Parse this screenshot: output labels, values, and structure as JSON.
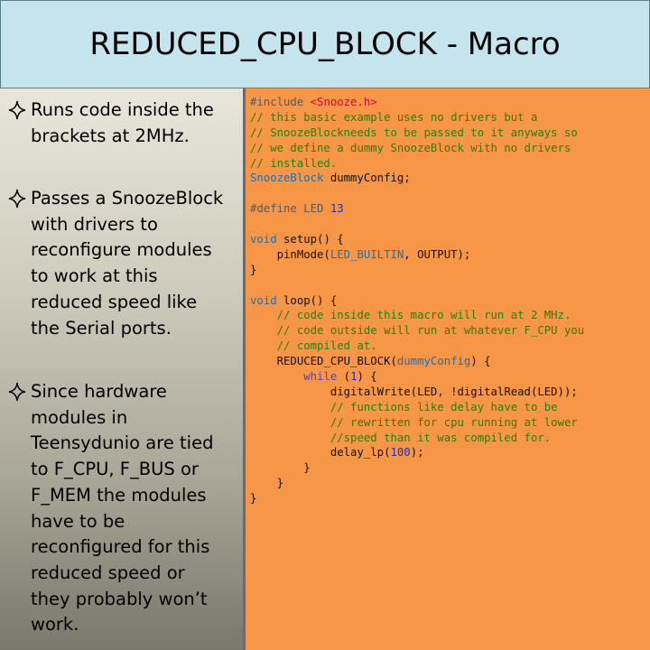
{
  "title": "REDUCED_CPU_BLOCK - Macro",
  "bullets": [
    {
      "icon": "four-pointed-star-icon",
      "lines": [
        "Runs code inside the",
        "brackets at 2MHz."
      ]
    },
    {
      "icon": "four-pointed-star-icon",
      "lines": [
        "Passes a SnoozeBlock",
        "with drivers to",
        "reconfigure modules",
        "to work at this",
        "reduced speed like",
        "the Serial ports."
      ]
    },
    {
      "icon": "four-pointed-star-icon",
      "lines": [
        "Since hardware",
        "modules in",
        "Teensydunio are tied",
        "to F_CPU, F_BUS or",
        "F_MEM the modules",
        "have to be",
        "reconfigured for this",
        "reduced speed or",
        "they probably won’t",
        "work."
      ]
    }
  ],
  "colors": {
    "title_background": "#c6e4ee",
    "code_background": "#f79646",
    "comment": "#2d7d0c",
    "string": "#c8102e",
    "type": "#1b6fb5",
    "number": "#2b2bb0",
    "keyword": "#5a3fb8"
  },
  "code_lines": [
    [
      {
        "c": "t-pre",
        "t": "#include "
      },
      {
        "c": "t-str",
        "t": "<Snooze.h>"
      }
    ],
    [
      {
        "c": "t-com",
        "t": "// this basic example uses no drivers but a"
      }
    ],
    [
      {
        "c": "t-com",
        "t": "// SnoozeBlockneeds to be passed to it anyways so"
      }
    ],
    [
      {
        "c": "t-com",
        "t": "// we define a dummy SnoozeBlock with no drivers"
      }
    ],
    [
      {
        "c": "t-com",
        "t": "// installed."
      }
    ],
    [
      {
        "c": "t-typ",
        "t": "SnoozeBlock"
      },
      {
        "c": "t-plain",
        "t": " dummyConfig;"
      }
    ],
    [],
    [
      {
        "c": "t-pre",
        "t": "#define LED "
      },
      {
        "c": "t-num",
        "t": "13"
      }
    ],
    [],
    [
      {
        "c": "t-typ",
        "t": "void"
      },
      {
        "c": "t-plain",
        "t": " setup() {"
      }
    ],
    [
      {
        "c": "t-plain",
        "t": "    pinMode("
      },
      {
        "c": "t-typ",
        "t": "LED_BUILTIN"
      },
      {
        "c": "t-plain",
        "t": ", OUTPUT);"
      }
    ],
    [
      {
        "c": "t-plain",
        "t": "}"
      }
    ],
    [],
    [
      {
        "c": "t-typ",
        "t": "void"
      },
      {
        "c": "t-plain",
        "t": " loop() {"
      }
    ],
    [
      {
        "c": "t-com",
        "t": "    // code inside this macro will run at 2 MHz."
      }
    ],
    [
      {
        "c": "t-com",
        "t": "    // code outside will run at whatever F_CPU you"
      }
    ],
    [
      {
        "c": "t-com",
        "t": "    // compiled at."
      }
    ],
    [
      {
        "c": "t-plain",
        "t": "    REDUCED_CPU_BLOCK("
      },
      {
        "c": "t-typ",
        "t": "dummyConfig"
      },
      {
        "c": "t-plain",
        "t": ") {"
      }
    ],
    [
      {
        "c": "t-kw",
        "t": "        while"
      },
      {
        "c": "t-plain",
        "t": " ("
      },
      {
        "c": "t-num",
        "t": "1"
      },
      {
        "c": "t-plain",
        "t": ") {"
      }
    ],
    [
      {
        "c": "t-plain",
        "t": "            digitalWrite(LED, !digitalRead(LED));"
      }
    ],
    [
      {
        "c": "t-com",
        "t": "            // functions like delay have to be"
      }
    ],
    [
      {
        "c": "t-com",
        "t": "            // rewritten for cpu running at lower"
      }
    ],
    [
      {
        "c": "t-com",
        "t": "            //speed than it was compiled for."
      }
    ],
    [
      {
        "c": "t-plain",
        "t": "            delay_lp("
      },
      {
        "c": "t-num",
        "t": "100"
      },
      {
        "c": "t-plain",
        "t": ");"
      }
    ],
    [
      {
        "c": "t-plain",
        "t": "        }"
      }
    ],
    [
      {
        "c": "t-plain",
        "t": "    }"
      }
    ],
    [
      {
        "c": "t-plain",
        "t": "}"
      }
    ]
  ]
}
